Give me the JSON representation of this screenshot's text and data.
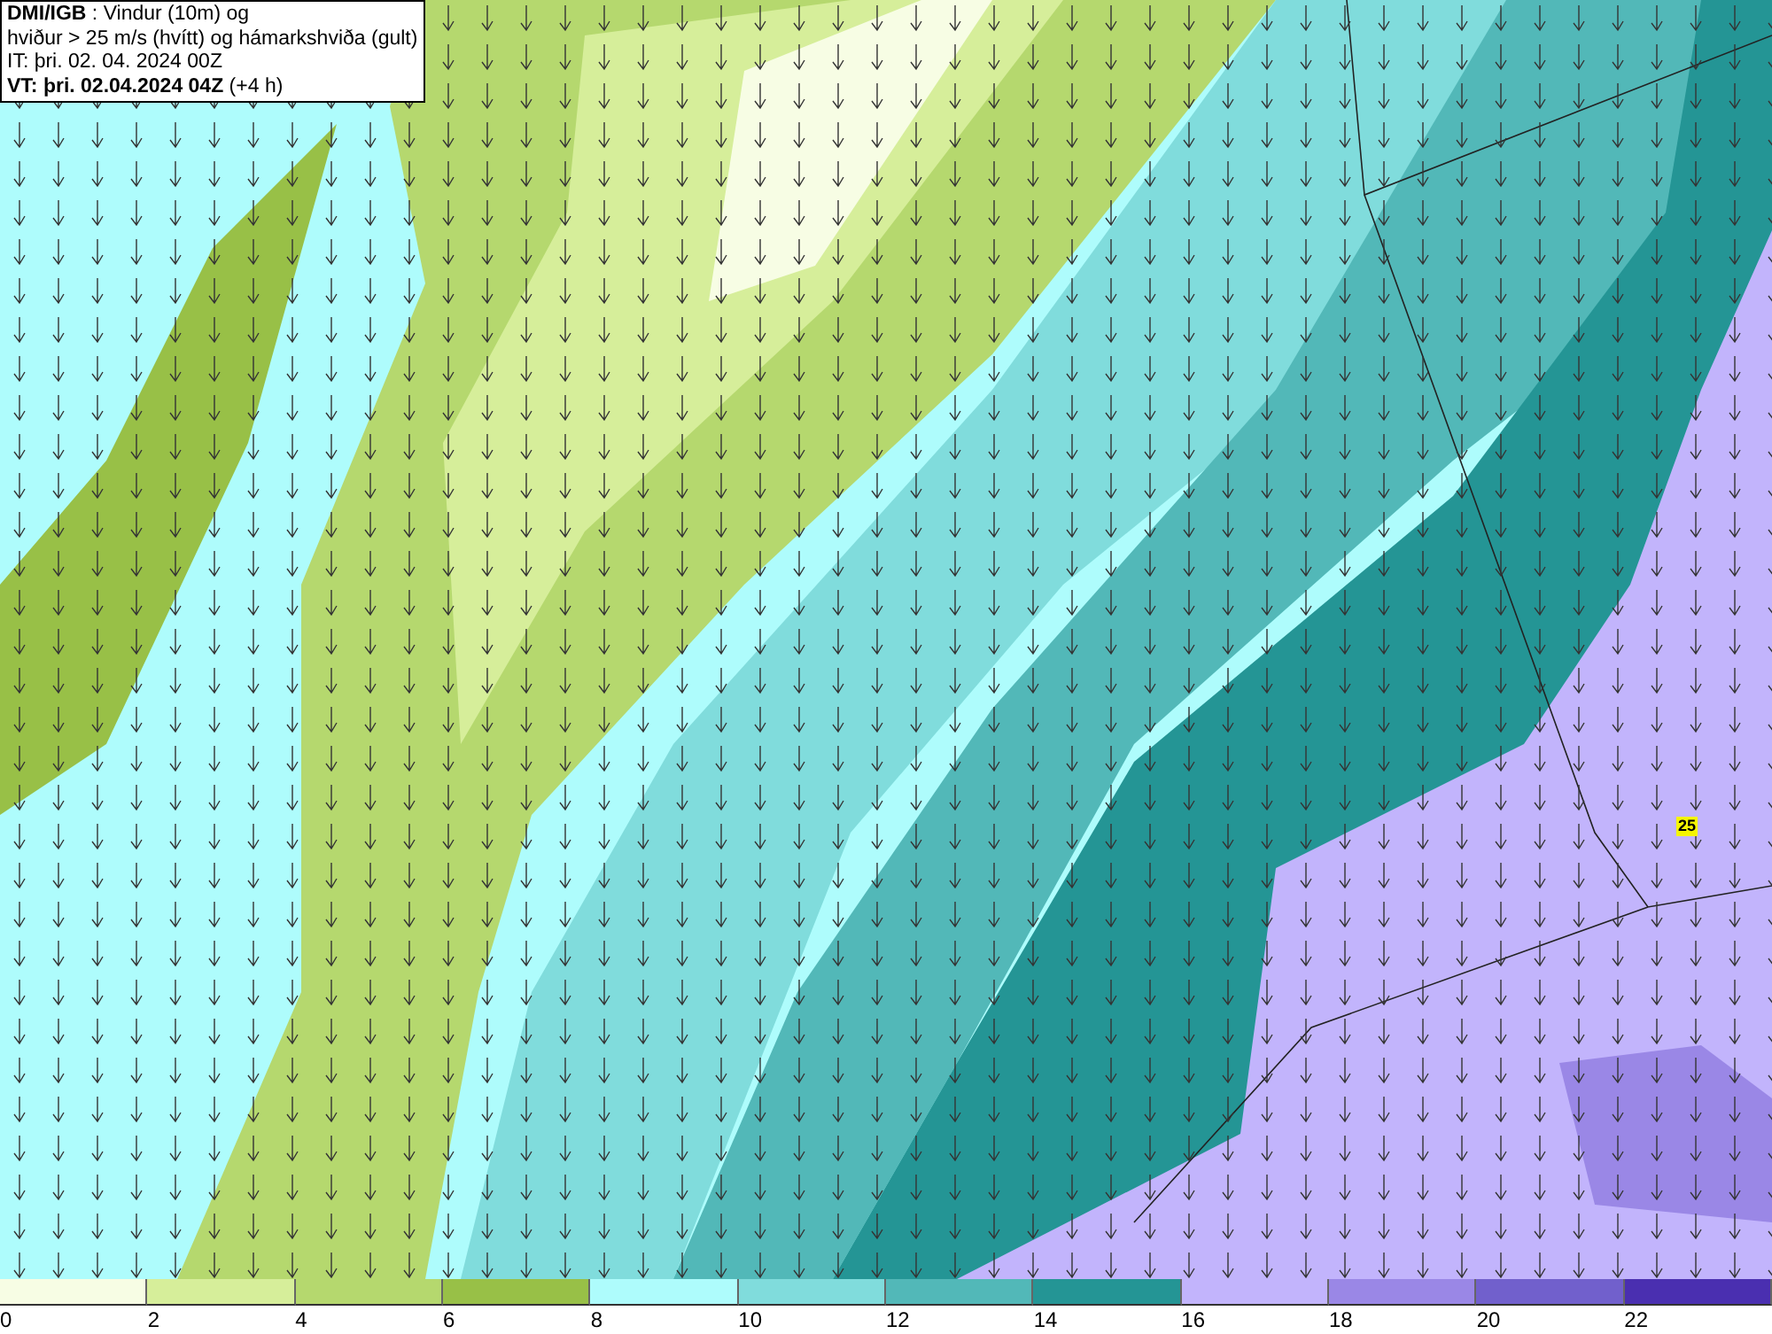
{
  "info_box": {
    "lines": [
      "**DMI/IGB** : Vindur (10m) og",
      "hviður > 25 m/s (hvítt) og hámarkshviða (gult)",
      "IT: þri. 02. 04. 2024 00Z",
      "**VT: þri. 02.04.2024 04Z** (+4 h)"
    ]
  },
  "map": {
    "markers": [
      {
        "label": "25"
      }
    ]
  },
  "legend": [
    {
      "label": "0",
      "color": "#f7fde4"
    },
    {
      "label": "2",
      "color": "#d6ee9a"
    },
    {
      "label": "4",
      "color": "#b5d86e"
    },
    {
      "label": "6",
      "color": "#98c047"
    },
    {
      "label": "8",
      "color": "#aefcfc"
    },
    {
      "label": "10",
      "color": "#80dcdc"
    },
    {
      "label": "12",
      "color": "#52b8b8"
    },
    {
      "label": "14",
      "color": "#249595"
    },
    {
      "label": "16",
      "color": "#c2b4fc"
    },
    {
      "label": "18",
      "color": "#9a87e6"
    },
    {
      "label": "20",
      "color": "#7160cc"
    },
    {
      "label": "22",
      "color": "#4a2fb0"
    }
  ]
}
